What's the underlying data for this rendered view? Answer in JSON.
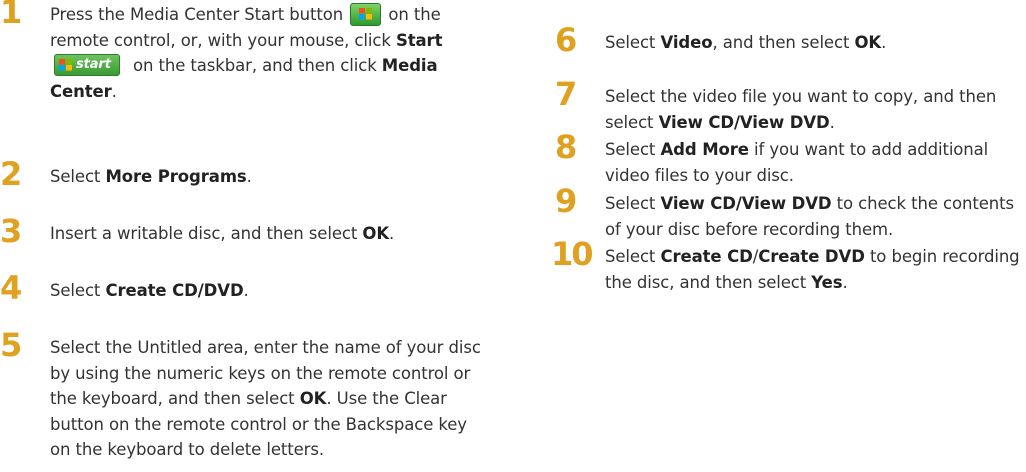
{
  "colors": {
    "step_number": "#e0a020",
    "start_button": "#3a9a34"
  },
  "icons": {
    "media_center_button": "windows-flag-icon",
    "start_button": "windows-flag-icon"
  },
  "left_steps": [
    {
      "number": "1",
      "segments": [
        {
          "t": "Press the Media Center Start button ",
          "b": false
        },
        {
          "icon": "media-center-button"
        },
        {
          "t": " on the remote control, or, with your mouse, click ",
          "b": false
        },
        {
          "t": "Start",
          "b": true
        },
        {
          "icon": "start-button"
        },
        {
          "t": " on the taskbar, and then click ",
          "b": false
        },
        {
          "t": "Media Center",
          "b": true
        },
        {
          "t": ".",
          "b": false
        }
      ]
    },
    {
      "number": "2",
      "segments": [
        {
          "t": "Select ",
          "b": false
        },
        {
          "t": "More Programs",
          "b": true
        },
        {
          "t": ".",
          "b": false
        }
      ]
    },
    {
      "number": "3",
      "segments": [
        {
          "t": "Insert a writable disc, and then select ",
          "b": false
        },
        {
          "t": "OK",
          "b": true
        },
        {
          "t": ".",
          "b": false
        }
      ]
    },
    {
      "number": "4",
      "segments": [
        {
          "t": "Select ",
          "b": false
        },
        {
          "t": "Create CD/DVD",
          "b": true
        },
        {
          "t": ".",
          "b": false
        }
      ]
    },
    {
      "number": "5",
      "segments": [
        {
          "t": "Select the Untitled area, enter the name of your disc by using the numeric keys on the remote control or the keyboard, and then select ",
          "b": false
        },
        {
          "t": "OK",
          "b": true
        },
        {
          "t": ". Use the Clear button on the remote control or the Backspace key on the keyboard to delete letters.",
          "b": false
        }
      ]
    }
  ],
  "right_steps": [
    {
      "number": "6",
      "segments": [
        {
          "t": "Select ",
          "b": false
        },
        {
          "t": "Video",
          "b": true
        },
        {
          "t": ", and then select ",
          "b": false
        },
        {
          "t": "OK",
          "b": true
        },
        {
          "t": ".",
          "b": false
        }
      ]
    },
    {
      "number": "7",
      "segments": [
        {
          "t": "Select the video file you want to copy, and then select ",
          "b": false
        },
        {
          "t": "View CD/View DVD",
          "b": true
        },
        {
          "t": ".",
          "b": false
        }
      ]
    },
    {
      "number": "8",
      "segments": [
        {
          "t": "Select ",
          "b": false
        },
        {
          "t": "Add More",
          "b": true
        },
        {
          "t": " if you want to add additional video files to your disc.",
          "b": false
        }
      ]
    },
    {
      "number": "9",
      "segments": [
        {
          "t": "Select ",
          "b": false
        },
        {
          "t": "View CD/View DVD",
          "b": true
        },
        {
          "t": " to check the contents of your disc before recording them.",
          "b": false
        }
      ]
    },
    {
      "number": "10",
      "segments": [
        {
          "t": "Select ",
          "b": false
        },
        {
          "t": "Create CD",
          "b": true
        },
        {
          "t": "/",
          "b": false
        },
        {
          "t": "Create DVD",
          "b": true
        },
        {
          "t": " to begin recording the disc, and then select ",
          "b": false
        },
        {
          "t": "Yes",
          "b": true
        },
        {
          "t": ".",
          "b": false
        }
      ]
    }
  ],
  "start_button_label": "start"
}
